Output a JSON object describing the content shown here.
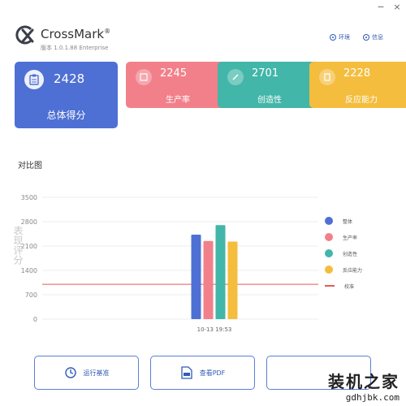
{
  "window": {
    "minimize": "−",
    "close": "×"
  },
  "app": {
    "name": "CrossMark",
    "registered": "®",
    "version": "版本 1.0.1.88 Enterprise"
  },
  "top_links": {
    "environment": "环境",
    "info": "信息"
  },
  "cards": {
    "total": {
      "score": "2428",
      "label": "总体得分",
      "color": "#4e70d4"
    },
    "productivity": {
      "score": "2245",
      "label": "生产率",
      "color": "#f2808a"
    },
    "creativity": {
      "score": "2701",
      "label": "创造性",
      "color": "#42b6a8"
    },
    "responsiveness": {
      "score": "2228",
      "label": "反应能力",
      "color": "#f4bd3e"
    }
  },
  "section": {
    "title": "对比图"
  },
  "chart_data": {
    "type": "bar",
    "ylabel": "表现评分",
    "ylim": [
      0,
      3500
    ],
    "yticks": [
      0,
      700,
      1400,
      2100,
      2800,
      3500
    ],
    "categories": [
      "10-13 19:53"
    ],
    "series": [
      {
        "name": "整体",
        "values": [
          2428
        ],
        "color": "#4e70d4"
      },
      {
        "name": "生产率",
        "values": [
          2245
        ],
        "color": "#f2808a"
      },
      {
        "name": "创造性",
        "values": [
          2701
        ],
        "color": "#42b6a8"
      },
      {
        "name": "反应能力",
        "values": [
          2228
        ],
        "color": "#f4bd3e"
      }
    ],
    "reference_line": {
      "name": "校准",
      "value": 1000,
      "color": "#e35a5a"
    },
    "grid": true,
    "legend": "right"
  },
  "buttons": {
    "run": "运行基准",
    "pdf": "查看PDF",
    "third": ""
  },
  "watermark": {
    "main": "装机之家",
    "sub": "gdhjbk.com"
  }
}
